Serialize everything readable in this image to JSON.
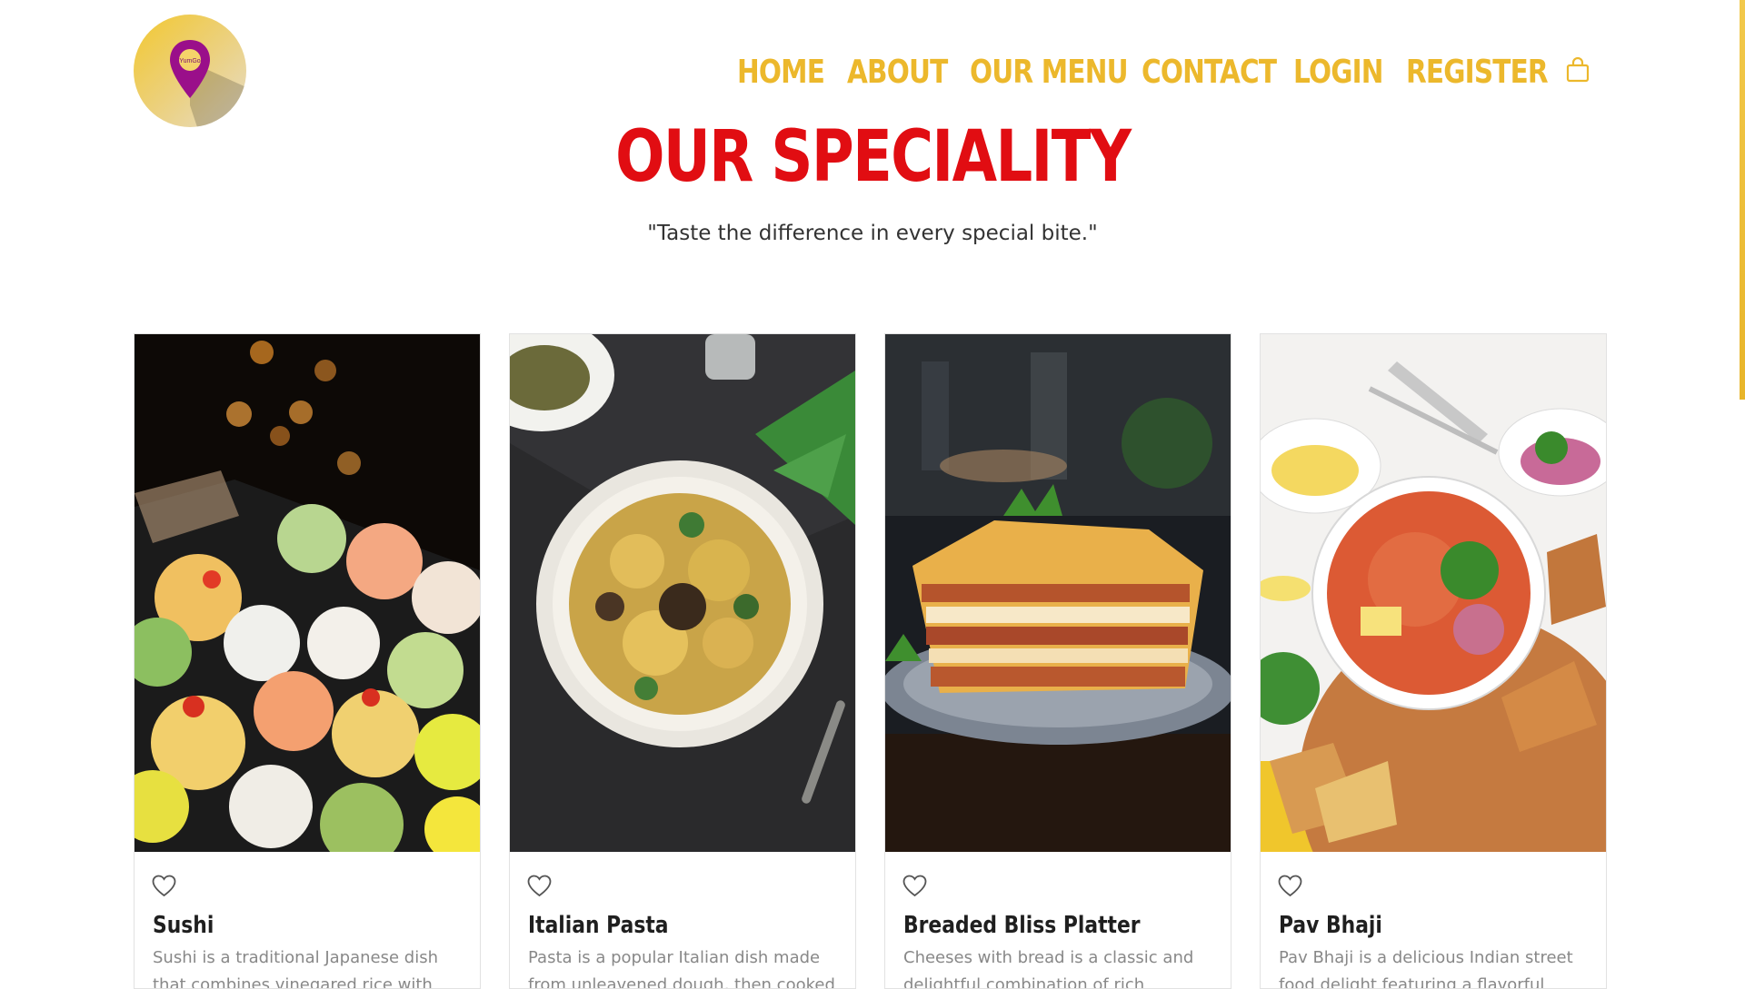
{
  "brand": {
    "logo_text": "YumGo"
  },
  "nav": {
    "items": [
      {
        "label": "HOME"
      },
      {
        "label": "ABOUT"
      },
      {
        "label": "OUR MENU"
      },
      {
        "label": "CONTACT"
      },
      {
        "label": "LOGIN"
      },
      {
        "label": "REGISTER"
      }
    ],
    "cart_icon": "shopping-bag-icon"
  },
  "section": {
    "title": "OUR SPECIALITY",
    "tagline": "\"Taste the difference in every special bite.\""
  },
  "cards": [
    {
      "title": "Sushi",
      "description": "Sushi is a traditional Japanese dish that combines vinegared rice with various",
      "icon": "heart-icon"
    },
    {
      "title": "Italian Pasta",
      "description": "Pasta is a popular Italian dish made from unleavened dough, then cooked in",
      "icon": "heart-icon"
    },
    {
      "title": "Breaded Bliss Platter",
      "description": "Cheeses with bread is a classic and delightful combination of rich textures",
      "icon": "heart-icon"
    },
    {
      "title": "Pav Bhaji",
      "description": "Pav Bhaji is a delicious Indian street food delight featuring a flavorful mashed",
      "icon": "heart-icon"
    }
  ],
  "colors": {
    "nav": "#ecb82c",
    "title": "#e10d12",
    "logo_pin": "#9a0f8a",
    "scrollbar": "#f2c94c"
  }
}
